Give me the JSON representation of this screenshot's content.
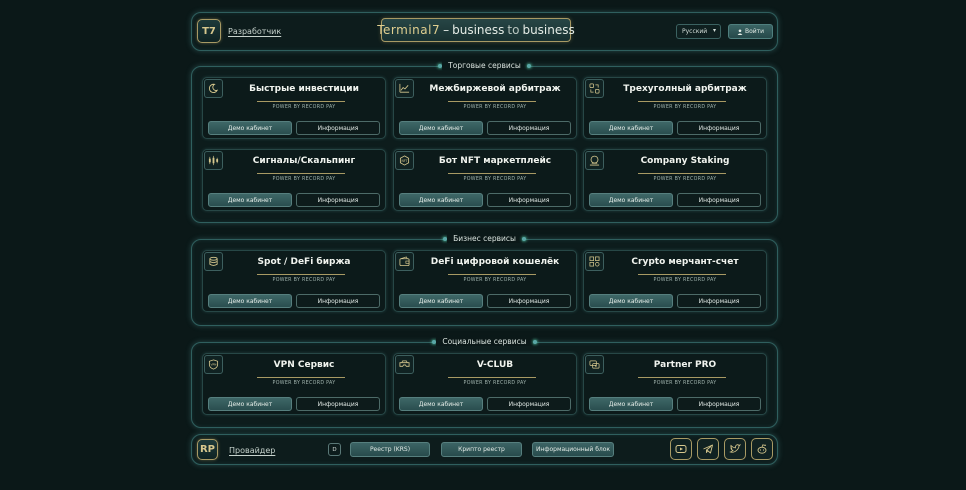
{
  "header": {
    "logo": "T7",
    "developer_label": "Разработчик",
    "brand_main": "Terminal7",
    "brand_dash": "–",
    "brand_b1": "business",
    "brand_to": "to",
    "brand_b2": "business",
    "language": "Русский",
    "login_label": "Войти"
  },
  "sections": [
    {
      "title": "Торговые сервисы",
      "cards": [
        {
          "title": "Быстрые инвестиции",
          "icon": "moon-icon"
        },
        {
          "title": "Межбиржевой арбитраж",
          "icon": "chart-line-icon"
        },
        {
          "title": "Трехуголный арбитраж",
          "icon": "exchange-icon"
        },
        {
          "title": "Сигналы/Скальпинг",
          "icon": "candles-icon"
        },
        {
          "title": "Бот NFT маркетплейс",
          "icon": "nft-icon"
        },
        {
          "title": "Company Staking",
          "icon": "staking-icon"
        }
      ]
    },
    {
      "title": "Бизнес сервисы",
      "cards": [
        {
          "title": "Spot / DeFi биржа",
          "icon": "coins-icon"
        },
        {
          "title": "DeFi цифровой кошелёк",
          "icon": "wallet-icon"
        },
        {
          "title": "Crypto мерчант-счет",
          "icon": "merchant-icon"
        }
      ]
    },
    {
      "title": "Социальные сервисы",
      "cards": [
        {
          "title": "VPN Сервис",
          "icon": "vpn-shield-icon"
        },
        {
          "title": "V-CLUB",
          "icon": "vr-glasses-icon"
        },
        {
          "title": "Partner PRO",
          "icon": "partner-icon"
        }
      ]
    }
  ],
  "card_common": {
    "power": "POWER BY RECORD PAY",
    "demo_label": "Демо кабинет",
    "info_label": "Информация"
  },
  "footer": {
    "logo": "RP",
    "provider_label": "Провайдер",
    "d_badge": "D",
    "registry_label": "Реестр (KRS)",
    "crypto_registry_label": "Крипто реестр",
    "info_block_label": "Информационный блок",
    "socials": [
      "youtube-icon",
      "telegram-icon",
      "twitter-icon",
      "reddit-icon"
    ]
  },
  "colors": {
    "background": "#0b1818",
    "accent_gold": "#a89a64",
    "teal_button": "#3e6767",
    "frame_glow": "#2f5f5e"
  }
}
